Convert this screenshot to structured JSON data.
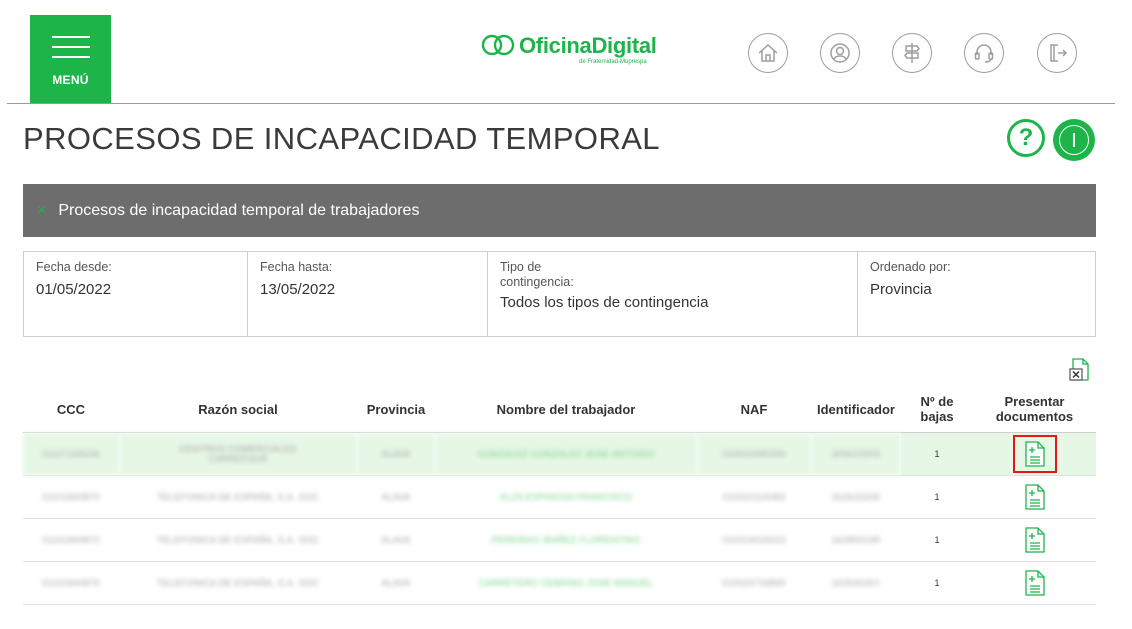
{
  "header": {
    "menu_label": "MENÚ",
    "logo_text": "OficinaDigital",
    "logo_sub": "de Fraternidad-Muprespa",
    "nav_icons": [
      "home-icon",
      "user-icon",
      "signpost-icon",
      "headset-icon",
      "logout-icon"
    ]
  },
  "page": {
    "title": "PROCESOS DE INCAPACIDAD TEMPORAL",
    "help_label": "?"
  },
  "section": {
    "close_glyph": "×",
    "title": "Procesos de incapacidad temporal de trabajadores"
  },
  "filters": {
    "fecha_desde": {
      "label": "Fecha desde:",
      "value": "01/05/2022"
    },
    "fecha_hasta": {
      "label": "Fecha hasta:",
      "value": "13/05/2022"
    },
    "tipo": {
      "label1": "Tipo de",
      "label2": "contingencia:",
      "value": "Todos los tipos de contingencia"
    },
    "orden": {
      "label": "Ordenado por:",
      "value": "Provincia"
    }
  },
  "table": {
    "headers": {
      "ccc": "CCC",
      "razon": "Razón social",
      "provincia": "Provincia",
      "nombre": "Nombre del trabajador",
      "naf": "NAF",
      "ident": "Identificador",
      "bajas1": "Nº de",
      "bajas2": "bajas",
      "presentar1": "Presentar",
      "presentar2": "documentos"
    },
    "rows": [
      {
        "ccc": "01107168106",
        "razon1": "CENTROS COMERCIALES",
        "razon2": "CARREFOUR",
        "provincia": "ALAVA",
        "nombre": "GONZALEZ GONZALEZ JOSE ANTONIO",
        "naf": "010010080293",
        "ident": "30561020S",
        "bajas": "1"
      },
      {
        "ccc": "01101840870",
        "razon1": "TELEFONICA DE ESPAÑA, S.A. SOC",
        "razon2": "",
        "provincia": "ALAVA",
        "nombre": "ALZA ESPINOSA FRANCISCO",
        "naf": "010022115083",
        "ident": "16263320E",
        "bajas": "1"
      },
      {
        "ccc": "01101840870",
        "razon1": "TELEFONICA DE ESPAÑA, S.A. SOC",
        "razon2": "",
        "provincia": "ALAVA",
        "nombre": "PEREIRAS IBAÑEZ FLORENTINO",
        "naf": "010024015023",
        "ident": "16285023R",
        "bajas": "1"
      },
      {
        "ccc": "01101840870",
        "razon1": "TELEFONICA DE ESPAÑA, S.A. SOC",
        "razon2": "",
        "provincia": "ALAVA",
        "nombre": "CARRETERO CEBRINO JOSE MANUEL",
        "naf": "010024733890",
        "ident": "16294026Y",
        "bajas": "1"
      }
    ]
  },
  "colors": {
    "brand_green": "#1db54a",
    "section_bar": "#6d6d6d",
    "highlight_row": "#e6f7e6",
    "selection": "#e01818"
  }
}
